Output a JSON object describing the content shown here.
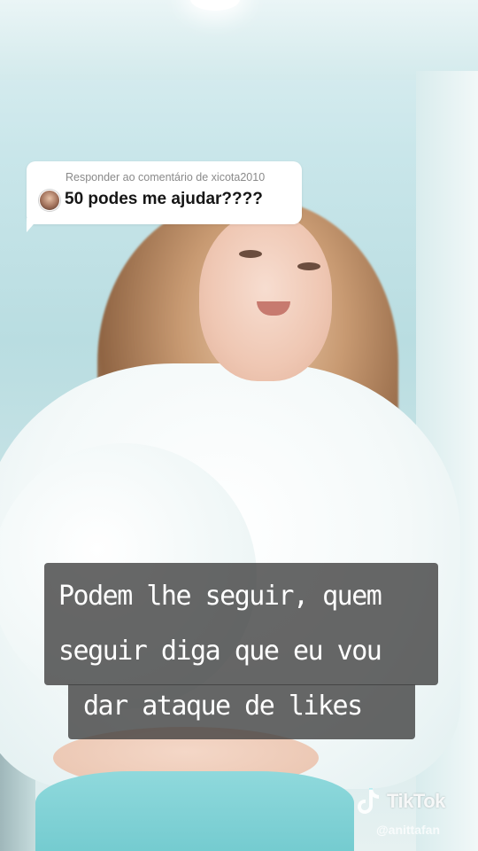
{
  "reply_sticker": {
    "caption": "Responder ao comentário de xicota2010",
    "comment": "50 podes me ajudar????",
    "avatar_icon": "user-avatar-icon"
  },
  "video_caption": {
    "lines": [
      "Podem lhe seguir, quem",
      "seguir diga que eu vou",
      "dar ataque de likes"
    ]
  },
  "watermark": {
    "brand": "TikTok",
    "handle": "@anittafan",
    "logo_icon": "tiktok-logo-icon"
  },
  "colors": {
    "caption_background": "#3c3c3c",
    "sticker_background": "#ffffff",
    "scene_tint": "#c9e6ea"
  }
}
